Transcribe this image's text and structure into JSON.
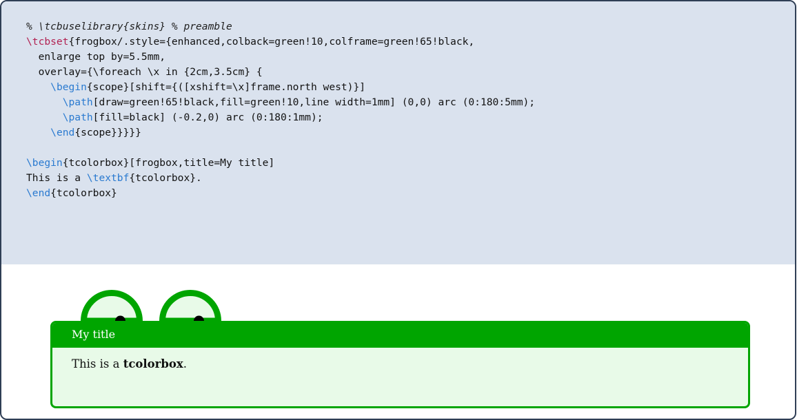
{
  "listing": {
    "lines": [
      [
        {
          "t": "% \\tcbuselibrary{skins} % preamble",
          "c": "comment"
        }
      ],
      [
        {
          "t": "\\tcbset",
          "c": "kw-red"
        },
        {
          "t": "{frogbox/.style={enhanced,colback=green!10,colframe=green!65!black,",
          "c": ""
        }
      ],
      [
        {
          "t": "  enlarge top by=5.5mm,",
          "c": ""
        }
      ],
      [
        {
          "t": "  overlay={\\foreach \\x in {2cm,3.5cm} {",
          "c": ""
        }
      ],
      [
        {
          "t": "    ",
          "c": ""
        },
        {
          "t": "\\begin",
          "c": "kw-blue"
        },
        {
          "t": "{scope}[shift={([xshift=\\x]frame.north west)}]",
          "c": ""
        }
      ],
      [
        {
          "t": "      ",
          "c": ""
        },
        {
          "t": "\\path",
          "c": "kw-blue"
        },
        {
          "t": "[draw=green!65!black,fill=green!10,line width=1mm] (0,0) arc (0:180:5mm);",
          "c": ""
        }
      ],
      [
        {
          "t": "      ",
          "c": ""
        },
        {
          "t": "\\path",
          "c": "kw-blue"
        },
        {
          "t": "[fill=black] (-0.2,0) arc (0:180:1mm);",
          "c": ""
        }
      ],
      [
        {
          "t": "    ",
          "c": ""
        },
        {
          "t": "\\end",
          "c": "kw-blue"
        },
        {
          "t": "{scope}}}}}",
          "c": ""
        }
      ],
      [
        {
          "t": "",
          "c": ""
        }
      ],
      [
        {
          "t": "\\begin",
          "c": "kw-blue"
        },
        {
          "t": "{tcolorbox}[frogbox,title=My title]",
          "c": ""
        }
      ],
      [
        {
          "t": "This is a ",
          "c": ""
        },
        {
          "t": "\\textbf",
          "c": "kw-blue"
        },
        {
          "t": "{tcolorbox}.",
          "c": ""
        }
      ],
      [
        {
          "t": "\\end",
          "c": "kw-blue"
        },
        {
          "t": "{tcolorbox}",
          "c": ""
        }
      ]
    ]
  },
  "result": {
    "title": "My title",
    "body_prefix": "This is a ",
    "body_bold": "tcolorbox",
    "body_suffix": "."
  },
  "colors": {
    "frame": "#2f3e55",
    "code_background": "#dae2ee",
    "frog_green": "#00a500",
    "frog_back": "#e8fae8",
    "keyword_red": "#b22252",
    "keyword_blue": "#2a7ad0"
  }
}
